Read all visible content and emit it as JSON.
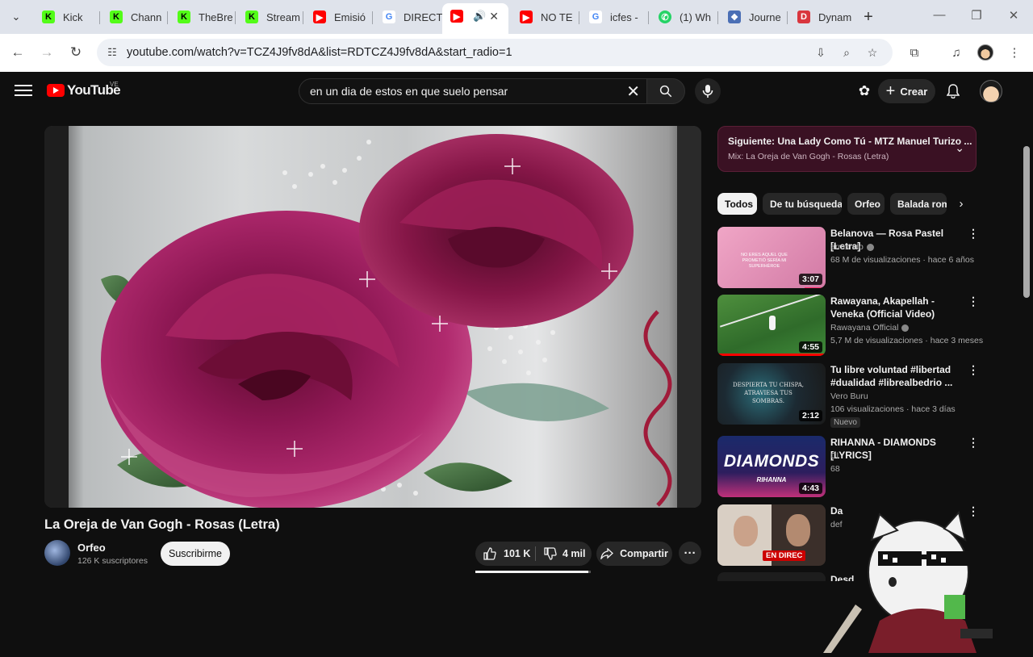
{
  "browser": {
    "tabs": [
      {
        "label": "Kick",
        "favicon": "kick-icon",
        "fav_text": "K",
        "fav_class": "fav-kick"
      },
      {
        "label": "Chann",
        "favicon": "kick-icon",
        "fav_text": "K",
        "fav_class": "fav-kick"
      },
      {
        "label": "TheBre",
        "favicon": "kick-icon",
        "fav_text": "K",
        "fav_class": "fav-kick"
      },
      {
        "label": "Stream",
        "favicon": "kick-icon",
        "fav_text": "K",
        "fav_class": "fav-kick"
      },
      {
        "label": "Emisió",
        "favicon": "youtube-icon",
        "fav_text": "▶",
        "fav_class": "fav-yt"
      },
      {
        "label": "DIRECT",
        "favicon": "google-icon",
        "fav_text": "G",
        "fav_class": "fav-g"
      },
      {
        "label": "",
        "favicon": "youtube-icon",
        "fav_text": "▶",
        "fav_class": "fav-yt",
        "active": true
      },
      {
        "label": "NO TE",
        "favicon": "youtube-icon",
        "fav_text": "▶",
        "fav_class": "fav-yt"
      },
      {
        "label": "icfes -",
        "favicon": "google-icon",
        "fav_text": "G",
        "fav_class": "fav-g"
      },
      {
        "label": "(1) Wh",
        "favicon": "whatsapp-icon",
        "fav_text": "✆",
        "fav_class": "fav-wa"
      },
      {
        "label": "Journe",
        "favicon": "journey-icon",
        "fav_text": "❖",
        "fav_class": "fav-j"
      },
      {
        "label": "Dynam",
        "favicon": "dynamics-icon",
        "fav_text": "D",
        "fav_class": "fav-d"
      }
    ],
    "url": "youtube.com/watch?v=TCZ4J9fv8dA&list=RDTCZ4J9fv8dA&start_radio=1"
  },
  "youtube": {
    "logo_text": "YouTube",
    "country_code": "VE",
    "search_value": "en un dia de estos en que suelo pensar",
    "create_label": "Crear",
    "video": {
      "title": "La Oreja de Van Gogh - Rosas (Letra)",
      "channel": "Orfeo",
      "subscribers": "126 K suscriptores",
      "subscribe_label": "Suscribirme",
      "likes": "101 K",
      "dislikes": "4 mil",
      "share_label": "Compartir",
      "progress": 0.98
    },
    "playlist": {
      "next": "Siguiente: Una Lady Como Tú - MTZ Manuel Turizo ...",
      "mix": "Mix: La Oreja de Van Gogh - Rosas (Letra)"
    },
    "chips": [
      "Todos",
      "De tu búsqueda",
      "Orfeo",
      "Balada rom"
    ],
    "recommendations": [
      {
        "title": "Belanova — Rosa Pastel [Letra]",
        "channel": "armxndo",
        "meta": "68 M de visualizaciones · hace 6 años",
        "duration": "3:07",
        "thumb_text": "NO ERES AQUEL QUE PROMETIÓ SERÍA MI SUPERHÉROE"
      },
      {
        "title": "Rawayana, Akapellah - Veneka (Official Video)",
        "channel": "Rawayana Official",
        "meta": "5,7 M de visualizaciones · hace 3 meses",
        "duration": "4:55"
      },
      {
        "title": "Tu libre voluntad #libertad #dualidad #librealbedrio ...",
        "channel": "Vero Buru",
        "meta": "106 visualizaciones · hace 3 días",
        "duration": "2:12",
        "badge": "Nuevo",
        "thumb_text": "DESPIERTA TU CHISPA, ATRAVIESA TUS SOMBRAS."
      },
      {
        "title": "RIHANNA - DIAMONDS [LYRICS]",
        "channel": "Cl",
        "meta": "68",
        "duration": "4:43",
        "thumb_text": "DIAMONDS",
        "thumb_sub": "RIHANNA"
      },
      {
        "title": "Da",
        "channel": "def",
        "meta": "",
        "duration": "",
        "live": "EN DIREC"
      },
      {
        "title": "Desd",
        "channel": "",
        "meta": "",
        "duration": ""
      }
    ]
  }
}
